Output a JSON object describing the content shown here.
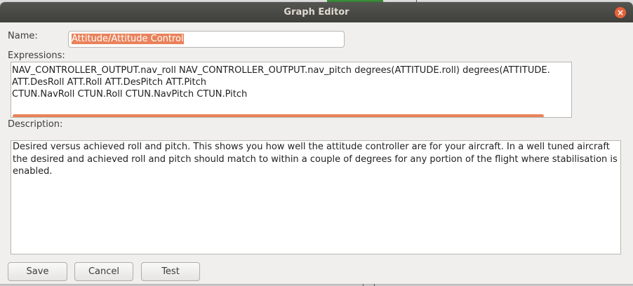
{
  "dialog": {
    "title": "Graph Editor",
    "close_icon": "×",
    "name_label": "Name:",
    "name_value": "Attitude/Attitude Control",
    "expressions_label": "Expressions:",
    "expressions": [
      "NAV_CONTROLLER_OUTPUT.nav_roll NAV_CONTROLLER_OUTPUT.nav_pitch degrees(ATTITUDE.roll) degrees(ATTITUDE.",
      "ATT.DesRoll ATT.Roll ATT.DesPitch ATT.Pitch",
      "CTUN.NavRoll CTUN.Roll CTUN.NavPitch CTUN.Pitch"
    ],
    "description_label": "Description:",
    "description": "Desired versus achieved roll and pitch. This shows you how well the attitude controller are for your aircraft. In a well tuned aircraft the desired and achieved roll and pitch should match to within a couple of degrees for any portion of the flight where stabilisation is enabled.",
    "buttons": {
      "save": "Save",
      "cancel": "Cancel",
      "test": "Test"
    }
  },
  "colors": {
    "accent": "#e9825a",
    "titlebar": "#4a4a46",
    "close": "#e8623a"
  }
}
